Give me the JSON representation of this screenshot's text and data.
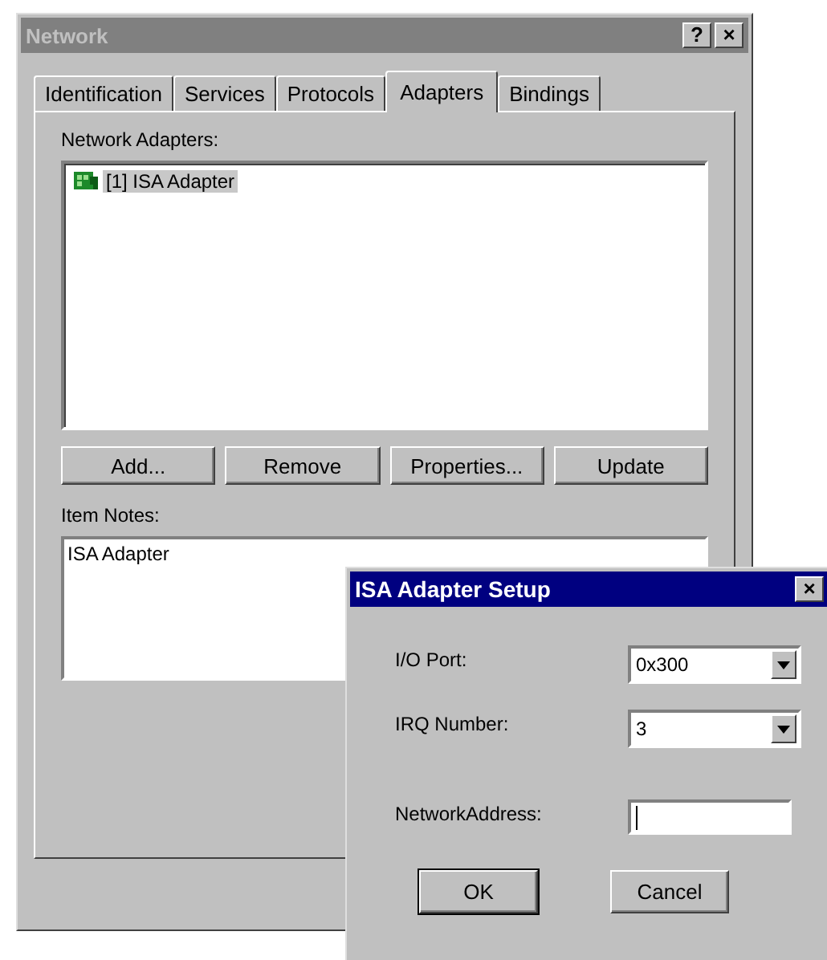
{
  "window": {
    "title": "Network",
    "help_button": "?",
    "close_button": "×"
  },
  "tabs": [
    {
      "label": "Identification",
      "selected": false
    },
    {
      "label": "Services",
      "selected": false
    },
    {
      "label": "Protocols",
      "selected": false
    },
    {
      "label": "Adapters",
      "selected": true
    },
    {
      "label": "Bindings",
      "selected": false
    }
  ],
  "adapters": {
    "label": "Network Adapters:",
    "items": [
      {
        "label": "[1] ISA Adapter",
        "selected": true
      }
    ]
  },
  "buttons": [
    "Add...",
    "Remove",
    "Properties...",
    "Update"
  ],
  "item_notes": {
    "label": "Item Notes:",
    "text": "ISA Adapter"
  },
  "dialog": {
    "title": "ISA Adapter Setup",
    "close_button": "×",
    "fields": [
      {
        "kind": "combo",
        "label": "I/O Port:",
        "value": "0x300"
      },
      {
        "kind": "combo",
        "label": "IRQ Number:",
        "value": "3"
      },
      {
        "kind": "text",
        "label": "NetworkAddress:"
      }
    ],
    "buttons": [
      {
        "label": "OK",
        "default": true
      },
      {
        "label": "Cancel",
        "default": false
      }
    ]
  }
}
